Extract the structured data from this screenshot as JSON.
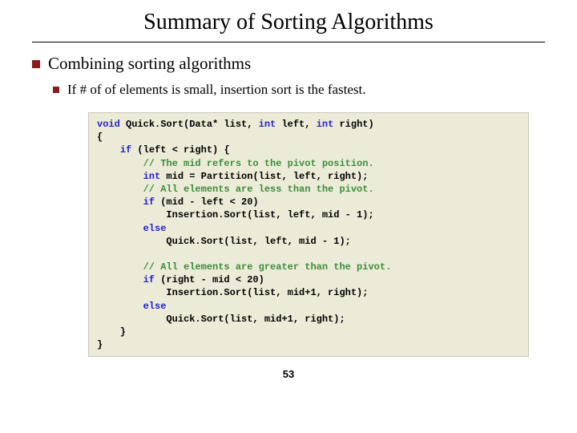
{
  "title": "Summary of Sorting Algorithms",
  "bullet1": "Combining sorting algorithms",
  "bullet2": "If # of of elements is small, insertion sort is the fastest.",
  "code": {
    "l01a": "void",
    "l01b": " Quick.Sort(Data* list, ",
    "l01c": "int",
    "l01d": " left, ",
    "l01e": "int",
    "l01f": " right)",
    "l02": "{",
    "l03a": "    ",
    "l03b": "if",
    "l03c": " (left < right) {",
    "l04a": "        ",
    "l04b": "// The mid refers to the pivot position.",
    "l05a": "        ",
    "l05b": "int",
    "l05c": " mid = Partition(list, left, right);",
    "l06a": "        ",
    "l06b": "// All elements are less than the pivot.",
    "l07a": "        ",
    "l07b": "if",
    "l07c": " (mid - left < 20)",
    "l08": "            Insertion.Sort(list, left, mid - 1);",
    "l09a": "        ",
    "l09b": "else",
    "l10": "            Quick.Sort(list, left, mid - 1);",
    "blank1": "",
    "l11a": "        ",
    "l11b": "// All elements are greater than the pivot.",
    "l12a": "        ",
    "l12b": "if",
    "l12c": " (right - mid < 20)",
    "l13": "            Insertion.Sort(list, mid+1, right);",
    "l14a": "        ",
    "l14b": "else",
    "l15": "            Quick.Sort(list, mid+1, right);",
    "l16": "    }",
    "l17": "}"
  },
  "pagenum": "53"
}
